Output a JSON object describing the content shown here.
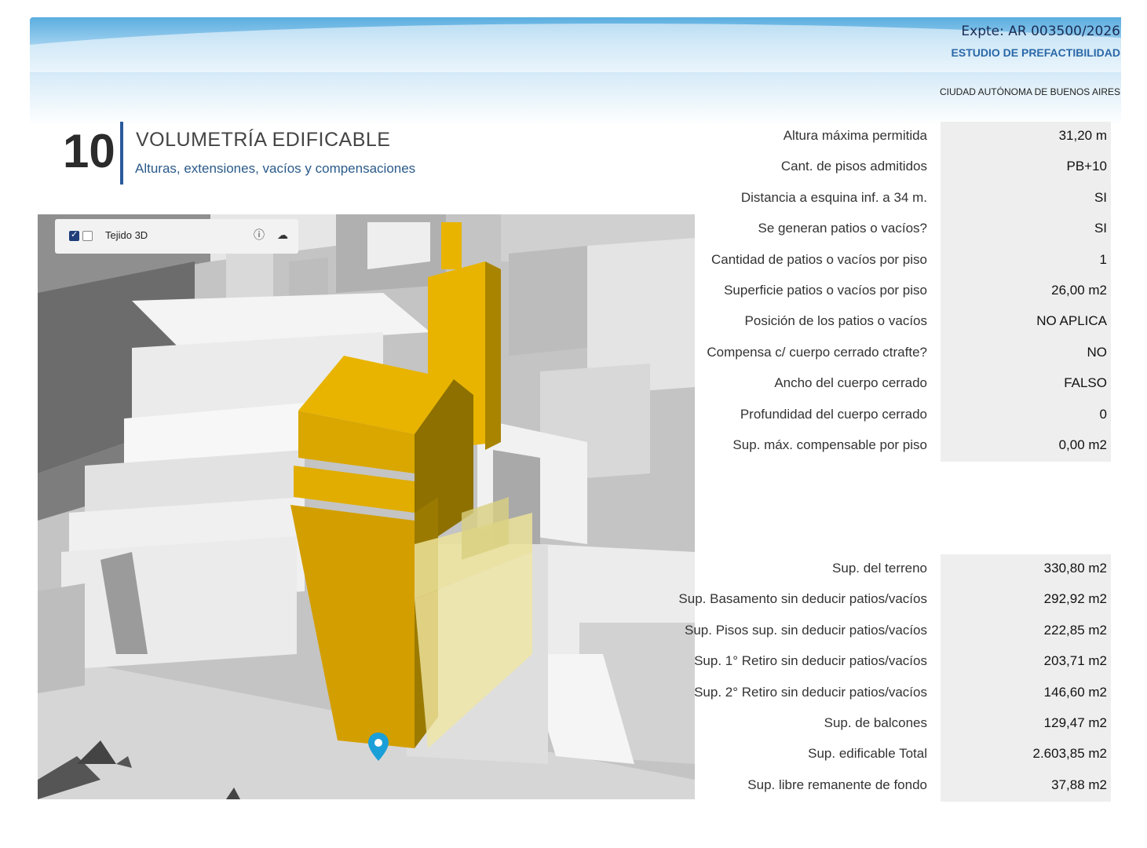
{
  "header": {
    "expte": "Expte: AR 003500/2026",
    "estudio": "ESTUDIO DE PREFACTIBILIDAD",
    "ciudad": "CIUDAD AUTÓNOMA DE BUENOS AIRES"
  },
  "section": {
    "number": "10",
    "title": "VOLUMETRÍA EDIFICABLE",
    "subtitle": "Alturas, extensiones, vacíos y compensaciones"
  },
  "map": {
    "layer_label": "Tejido 3D",
    "layer_checked": true,
    "info_icon": "info-icon",
    "cloud_icon": "cloud-upload-icon",
    "marker_icon": "location-pin-icon",
    "building_color": "#e8b400"
  },
  "table_top": [
    {
      "label": "Altura máxima permitida",
      "value": "31,20 m"
    },
    {
      "label": "Cant. de pisos admitidos",
      "value": "PB+10"
    },
    {
      "label": "Distancia a esquina inf. a 34 m.",
      "value": "SI"
    },
    {
      "label": "Se generan patios o vacíos?",
      "value": "SI"
    },
    {
      "label": "Cantidad de patios o vacíos por piso",
      "value": "1"
    },
    {
      "label": "Superficie patios o vacíos por piso",
      "value": "26,00 m2"
    },
    {
      "label": "Posición de los patios o vacíos",
      "value": "NO APLICA"
    },
    {
      "label": "Compensa c/ cuerpo cerrado ctrafte?",
      "value": "NO"
    },
    {
      "label": "Ancho del  cuerpo cerrado",
      "value": "FALSO"
    },
    {
      "label": "Profundidad del  cuerpo cerrado",
      "value": "0"
    },
    {
      "label": "Sup. máx. compensable por piso",
      "value": "0,00 m2"
    }
  ],
  "table_bottom": [
    {
      "label": "Sup. del terreno",
      "value": "330,80 m2"
    },
    {
      "label": "Sup. Basamento sin deducir patios/vacíos",
      "value": "292,92 m2"
    },
    {
      "label": "Sup. Pisos sup. sin deducir patios/vacíos",
      "value": "222,85 m2"
    },
    {
      "label": "Sup. 1° Retiro sin deducir patios/vacíos",
      "value": "203,71 m2"
    },
    {
      "label": "Sup. 2° Retiro sin deducir patios/vacíos",
      "value": "146,60 m2"
    },
    {
      "label": "Sup. de balcones",
      "value": "129,47 m2"
    },
    {
      "label": "Sup. edificable Total",
      "value": "2.603,85 m2"
    },
    {
      "label": "Sup. libre remanente de fondo",
      "value": "37,88 m2"
    }
  ]
}
